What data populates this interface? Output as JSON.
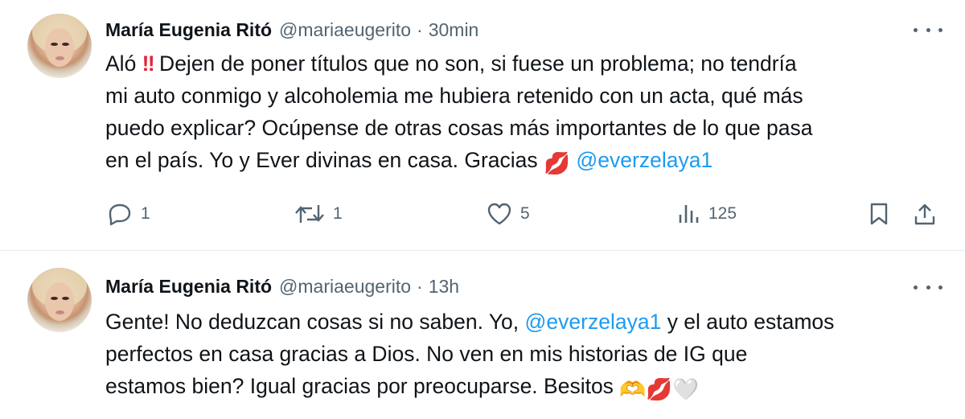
{
  "tweets": [
    {
      "author": {
        "name": "María Eugenia Ritó",
        "handle": "@mariaeugerito",
        "avatar": "profile-photo"
      },
      "separator": "·",
      "time": "30min",
      "lines": [
        {
          "parts": [
            "Aló ",
            "‼",
            " Dejen de poner títulos que no son, si fuese un problema; no tendría"
          ]
        },
        {
          "text": "mi auto conmigo y alcoholemia me hubiera retenido con un acta, qué más"
        },
        {
          "text": "puedo explicar? Ocúpense de otras cosas más importantes de lo que pasa"
        },
        {
          "parts": [
            "en el país. Yo y Ever divinas en casa. Gracias ",
            "💋",
            " ",
            "@everzelaya1"
          ]
        }
      ],
      "actions": {
        "reply": {
          "icon": "reply-icon",
          "count": "1"
        },
        "retweet": {
          "icon": "retweet-icon",
          "count": "1"
        },
        "like": {
          "icon": "heart-icon",
          "count": "5"
        },
        "views": {
          "icon": "views-icon",
          "count": "125"
        },
        "bookmark": {
          "icon": "bookmark-icon"
        },
        "share": {
          "icon": "share-icon"
        }
      }
    },
    {
      "author": {
        "name": "María Eugenia Ritó",
        "handle": "@mariaeugerito",
        "avatar": "profile-photo"
      },
      "separator": "·",
      "time": "13h",
      "lines": [
        {
          "parts": [
            "Gente! No deduzcan cosas si no saben. Yo, ",
            "@everzelaya1",
            " y el auto estamos"
          ]
        },
        {
          "text": "perfectos en casa gracias a Dios. No ven en mis historias de IG que"
        },
        {
          "parts": [
            "estamos bien? Igual gracias por preocuparse. Besitos ",
            "🫶",
            "💋",
            "🤍"
          ]
        }
      ]
    }
  ],
  "colors": {
    "text": "#0f1419",
    "muted": "#536471",
    "link": "#1d9bf0",
    "divider": "#e6ecf0"
  }
}
